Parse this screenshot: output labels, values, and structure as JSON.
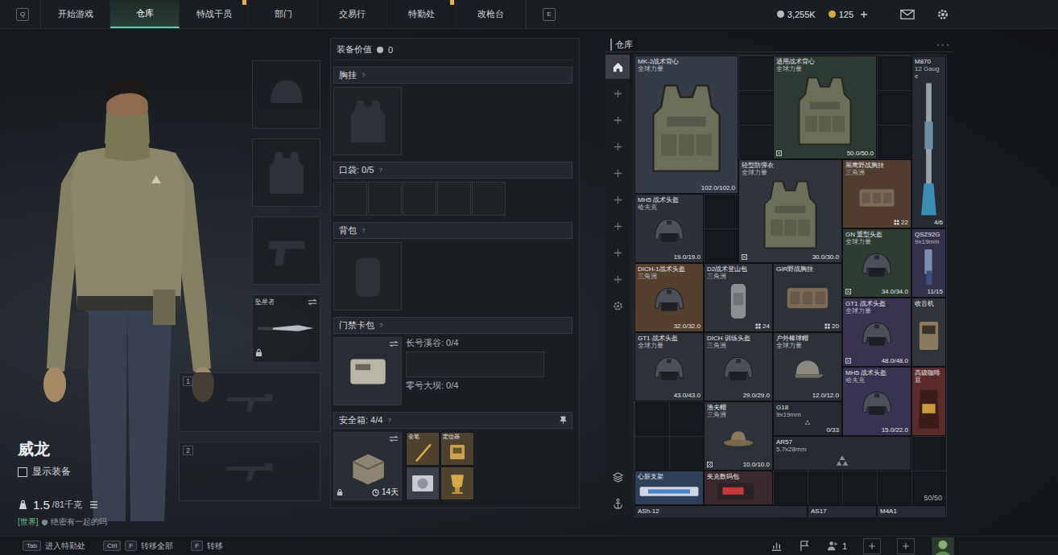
{
  "topbar": {
    "left_key": "Q",
    "right_key": "E",
    "tabs": [
      {
        "label": "开始游戏",
        "selected": false,
        "alert": false
      },
      {
        "label": "仓库",
        "selected": true,
        "alert": false
      },
      {
        "label": "特战干员",
        "selected": false,
        "alert": true
      },
      {
        "label": "部门",
        "selected": false,
        "alert": false
      },
      {
        "label": "交易行",
        "selected": false,
        "alert": false
      },
      {
        "label": "特勤处",
        "selected": false,
        "alert": true
      },
      {
        "label": "改枪台",
        "selected": false,
        "alert": false
      }
    ],
    "currency": [
      {
        "kind": "silver",
        "amount": "3,255K",
        "add": false
      },
      {
        "kind": "gold",
        "amount": "125",
        "add": true
      }
    ]
  },
  "operator": {
    "name": "威龙",
    "show_gear": {
      "label": "显示装备",
      "checked": false
    },
    "weight": {
      "current": "1.5",
      "max": "/81千克"
    },
    "chat": {
      "channel": "[世界]",
      "message": "绝密有一起的吗"
    }
  },
  "gear_slots": [
    {
      "kind": "helmet"
    },
    {
      "kind": "armor"
    },
    {
      "kind": "pistol"
    }
  ],
  "melee": {
    "label": "坠星者",
    "locked": true
  },
  "weapon_slots": [
    {
      "number": "1"
    },
    {
      "number": "2"
    }
  ],
  "loadout": {
    "value_label": "装备价值",
    "value": "0",
    "chest_rig": {
      "title": "胸挂",
      "help": "?"
    },
    "pockets": {
      "title": "口袋: 0/5",
      "help": "?",
      "slot_count": 5
    },
    "backpack": {
      "title": "背包",
      "help": "?"
    },
    "keycard": {
      "title": "门禁卡包",
      "help": "?",
      "maps": [
        "长号溪谷: 0/4",
        "零号大坝: 0/4"
      ]
    },
    "safe": {
      "title": "安全箱: 4/4",
      "help": "?",
      "timer": "14天",
      "locked": true,
      "items": [
        {
          "label": "金笔",
          "kind": "pen",
          "color": "#4f4330"
        },
        {
          "label": "定位器",
          "kind": "device",
          "color": "#4d4232"
        },
        {
          "kind": "disk",
          "color": "#3a3f4a"
        },
        {
          "kind": "cup",
          "color": "#4f4330"
        }
      ]
    }
  },
  "storage": {
    "title": "仓库",
    "capacity": "50/50",
    "sidebar": [
      {
        "kind": "home",
        "selected": true
      },
      {
        "kind": "add",
        "selected": false
      },
      {
        "kind": "add",
        "selected": false
      },
      {
        "kind": "add",
        "selected": false
      },
      {
        "kind": "add",
        "selected": false
      },
      {
        "kind": "add",
        "selected": false
      },
      {
        "kind": "add",
        "selected": false
      },
      {
        "kind": "add",
        "selected": false
      },
      {
        "kind": "add",
        "selected": false
      },
      {
        "kind": "settings",
        "selected": false
      }
    ],
    "tools": [
      {
        "kind": "layers"
      },
      {
        "kind": "anchor"
      }
    ],
    "items": [
      {
        "name": "MK-2战术背心",
        "sub": "全球力量",
        "kind": "vest",
        "reading": "102.0/102.0",
        "color": "#353b47",
        "marked": false
      },
      {
        "name": "通用战术背心",
        "sub": "全球力量",
        "kind": "vest",
        "reading": "50.0/50.0",
        "color": "#2d3a34",
        "marked": true
      },
      {
        "name": "M870",
        "sub": "12 Gauge",
        "kind": "longgun",
        "reading": "4/6",
        "color": "#262b33",
        "marked": false
      },
      {
        "name": "轻型防弹衣",
        "sub": "全球力量",
        "kind": "vest",
        "reading": "30.0/30.0",
        "color": "#30353d",
        "marked": true
      },
      {
        "name": "黑鹰野战胸挂",
        "sub": "三角洲",
        "kind": "chestrig",
        "count": "22",
        "color": "#523e31",
        "marked": false
      },
      {
        "name": "MH5 战术头盔",
        "sub": "哈夫克",
        "kind": "helmet",
        "reading": "19.0/19.0",
        "color": "#2c3038",
        "marked": false
      },
      {
        "name": "GN 重型头盔",
        "sub": "全球力量",
        "kind": "helmet",
        "reading": "34.0/34.0",
        "color": "#2e3b33",
        "marked": true
      },
      {
        "name": "QSZ92G",
        "sub": "9x19mm",
        "kind": "pistol",
        "reading": "11/15",
        "color": "#33324a",
        "marked": false
      },
      {
        "name": "DICH-1战术头盔",
        "sub": "三角洲",
        "kind": "helmet",
        "reading": "32.0/32.0",
        "color": "#54402f",
        "marked": false
      },
      {
        "name": "D2战术登山包",
        "sub": "三角洲",
        "kind": "bag",
        "count": "24",
        "color": "#2d3239",
        "marked": false
      },
      {
        "name": "GIR野战胸挂",
        "kind": "chestrig",
        "count": "20",
        "color": "#2d3239",
        "marked": false
      },
      {
        "name": "GT1 战术头盔",
        "sub": "全球力量",
        "kind": "helmet",
        "reading": "48.0/48.0",
        "color": "#393350",
        "marked": true
      },
      {
        "name": "收音机",
        "kind": "radio",
        "color": "#30353c",
        "marked": false
      },
      {
        "name": "GT1 战术头盔",
        "sub": "全球力量",
        "kind": "helmet",
        "reading": "43.0/43.0",
        "color": "#2d3239",
        "marked": false
      },
      {
        "name": "DICH 训练头盔",
        "sub": "三角洲",
        "kind": "helmet",
        "reading": "29.0/29.0",
        "color": "#2d3239",
        "marked": false
      },
      {
        "name": "户外棒球帽",
        "sub": "全球力量",
        "kind": "cap",
        "reading": "12.0/12.0",
        "color": "#2d3239",
        "marked": false
      },
      {
        "name": "MH5 战术头盔",
        "sub": "哈夫克",
        "kind": "helmet",
        "reading": "15.0/22.0",
        "color": "#383350",
        "marked": false
      },
      {
        "name": "高级咖啡豆",
        "kind": "coffee",
        "color": "#5a2b2b",
        "marked": false
      },
      {
        "name": "G18",
        "sub": "9x19mm",
        "kind": "placeholder",
        "reading": "0/33",
        "color": "#262b33",
        "marked": false
      },
      {
        "name": "渔夫帽",
        "sub": "三角洲",
        "kind": "hat",
        "reading": "10.0/10.0",
        "color": "#2d3239",
        "marked": true
      },
      {
        "name": "AR57",
        "sub": "5.7x28mm",
        "kind": "placeholder",
        "color": "#262b33",
        "marked": false
      },
      {
        "name": "心脏支架",
        "kind": "medkit",
        "color": "#2f3f57",
        "marked": false
      },
      {
        "name": "夹克数码包",
        "kind": "package",
        "color": "#3a2a30",
        "marked": false
      },
      {
        "name": "ASh-12",
        "kind": "cut",
        "color": "#262b33",
        "marked": false
      },
      {
        "name": "AS17",
        "kind": "cut",
        "color": "#262b33",
        "marked": false
      },
      {
        "name": "M4A1",
        "kind": "cut",
        "color": "#262b33",
        "marked": false
      }
    ]
  },
  "bottombar": {
    "hints": [
      {
        "keys": [
          "Tab"
        ],
        "label": "进入特勤处"
      },
      {
        "keys": [
          "Ctrl",
          "F"
        ],
        "label": "转移全部"
      },
      {
        "keys": [
          "F"
        ],
        "label": "转移"
      }
    ],
    "friends_online": "1"
  }
}
